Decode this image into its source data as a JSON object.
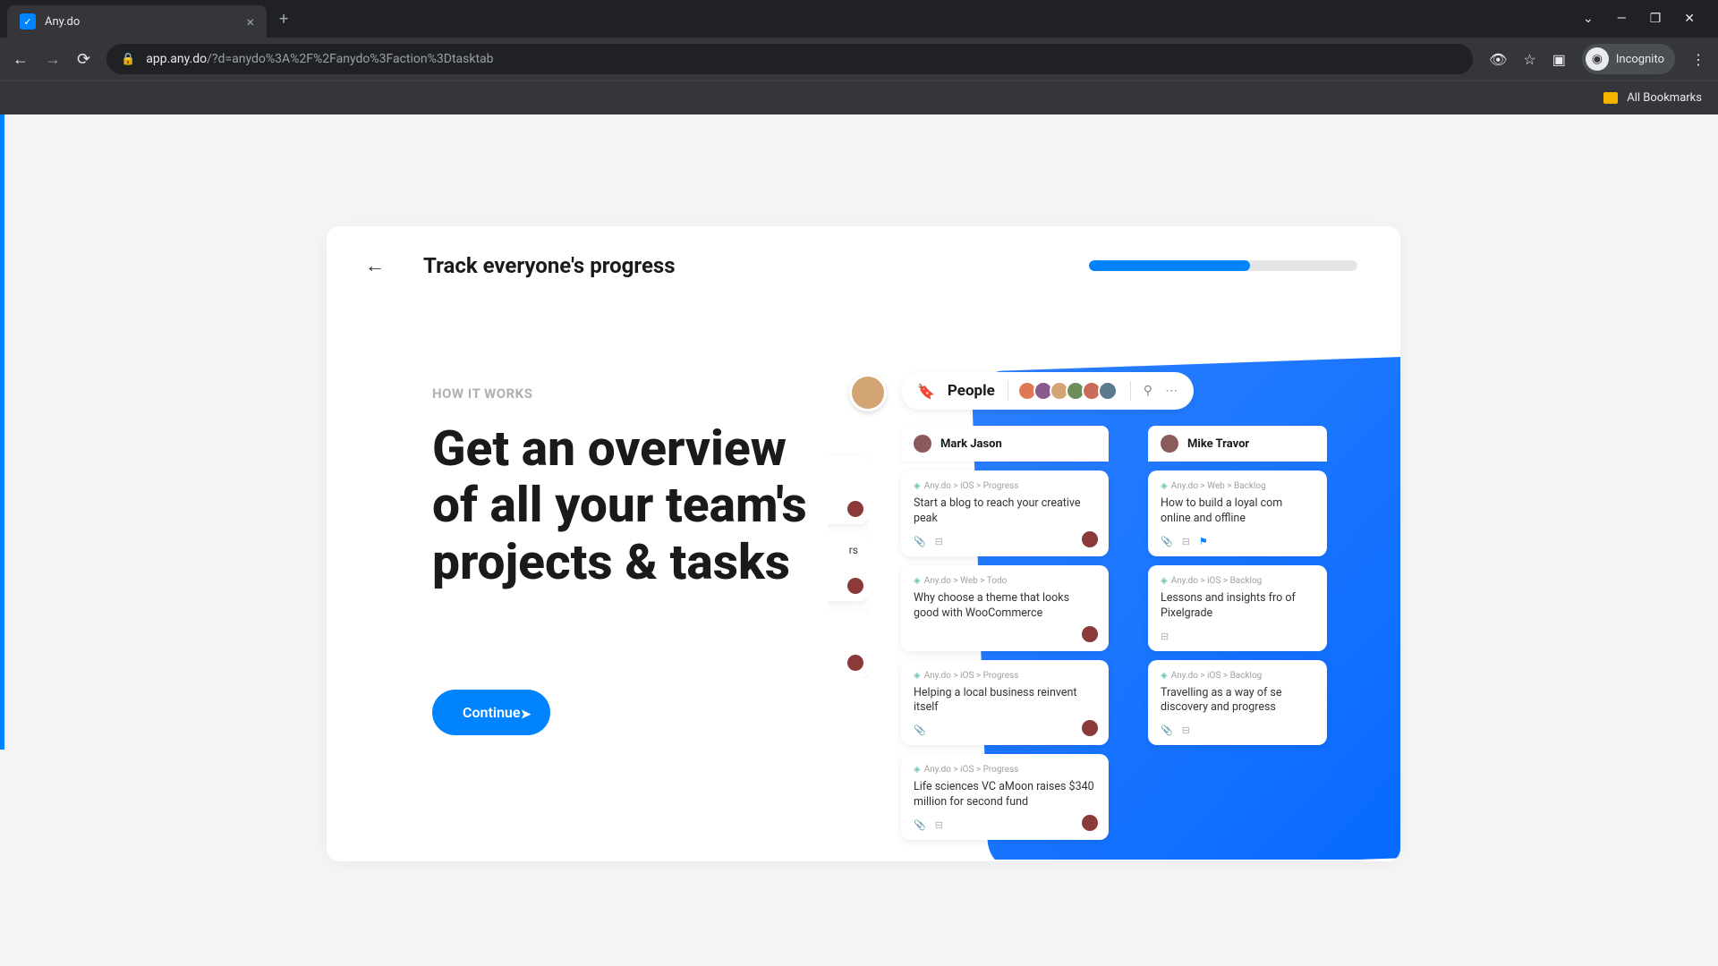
{
  "browser": {
    "tab_title": "Any.do",
    "url_host": "app.any.do",
    "url_path": "/?d=anydo%3A%2F%2Fanydo%3Faction%3Dtasktab",
    "incognito_label": "Incognito",
    "bookmarks_label": "All Bookmarks"
  },
  "onboarding": {
    "header_title": "Track everyone's progress",
    "progress_percent": 60,
    "eyebrow": "HOW IT WORKS",
    "headline": "Get an overview of all your team's projects & tasks",
    "continue_label": "Continue"
  },
  "people_label": "People",
  "columns": [
    {
      "name": "Mark Jason",
      "cards": [
        {
          "crumb": "Any.do > iOS > Progress",
          "title": "Start a blog to reach your creative peak",
          "has_attach": true,
          "has_sub": true,
          "has_assignee": true
        },
        {
          "crumb": "Any.do > Web > Todo",
          "title": "Why choose a theme that looks good with WooCommerce",
          "has_attach": false,
          "has_sub": false,
          "has_assignee": true
        },
        {
          "crumb": "Any.do > iOS > Progress",
          "title": "Helping a local business reinvent itself",
          "has_attach": true,
          "has_sub": false,
          "has_assignee": true
        },
        {
          "crumb": "Any.do > iOS > Progress",
          "title": "Life sciences VC aMoon raises $340 million for second fund",
          "has_attach": true,
          "has_sub": true,
          "has_assignee": true
        }
      ]
    },
    {
      "name": "Mike Travor",
      "cards": [
        {
          "crumb": "Any.do > Web > Backlog",
          "title": "How to build a loyal com online and offline",
          "has_attach": true,
          "has_sub": true,
          "has_assignee": false
        },
        {
          "crumb": "Any.do > iOS > Backlog",
          "title": "Lessons and insights fro of Pixelgrade",
          "has_attach": false,
          "has_sub": true,
          "has_assignee": false
        },
        {
          "crumb": "Any.do > iOS > Backlog",
          "title": "Travelling as a way of se discovery and progress",
          "has_attach": true,
          "has_sub": true,
          "has_assignee": false
        }
      ]
    }
  ],
  "edge_cards": [
    {
      "text": "rs"
    },
    {
      "text": ""
    },
    {
      "text": ""
    }
  ]
}
